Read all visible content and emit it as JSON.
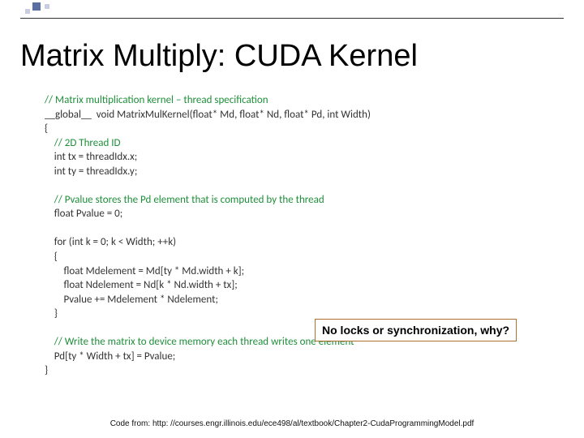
{
  "title": "Matrix Multiply:  CUDA Kernel",
  "code": {
    "l1": "// Matrix multiplication kernel – thread specification",
    "l2": "__global__  void MatrixMulKernel(float* Md, float* Nd, float* Pd, int Width)",
    "l3": "{",
    "l4": "    // 2D Thread ID",
    "l5": "    int tx = threadIdx.x;",
    "l6": "    int ty = threadIdx.y;",
    "blank1": "",
    "l7": "    // Pvalue stores the Pd element that is computed by the thread",
    "l8": "    float Pvalue = 0;",
    "blank2": "",
    "l9": "    for (int k = 0; k < Width; ++k)",
    "l10": "    {",
    "l11": "        float Mdelement = Md[ty * Md.width + k];",
    "l12": "        float Ndelement = Nd[k * Nd.width + tx];",
    "l13": "        Pvalue += Mdelement * Ndelement;",
    "l14": "    }",
    "blank3": "",
    "l15": "    // Write the matrix to device memory each thread writes one element",
    "l16": "    Pd[ty * Width + tx] = Pvalue;",
    "l17": "}"
  },
  "callout": "No locks or synchronization, why?",
  "footer": "Code from:  http: //courses.engr.illinois.edu/ece498/al/textbook/Chapter2-CudaProgrammingModel.pdf"
}
